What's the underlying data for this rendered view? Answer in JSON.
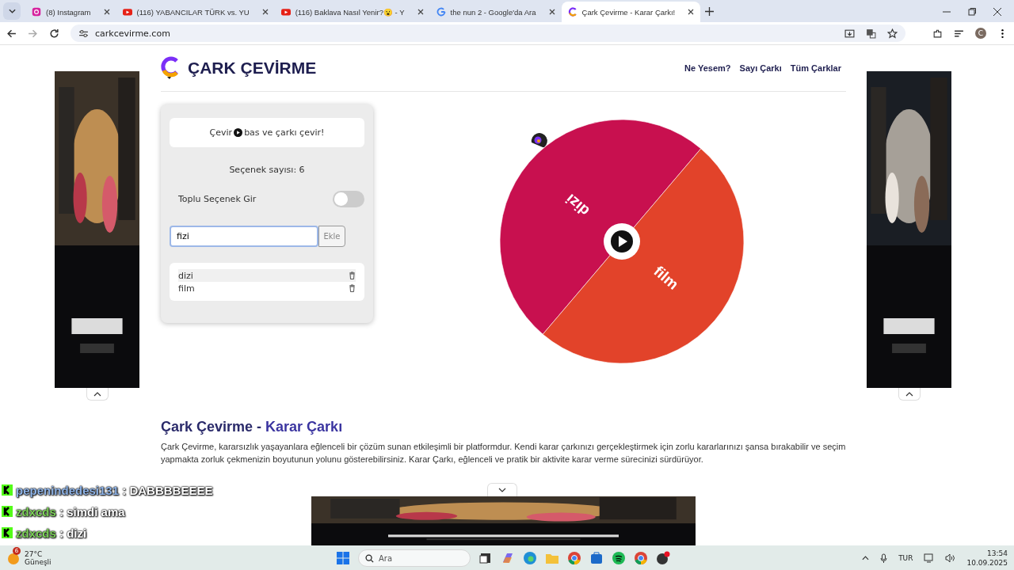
{
  "browser": {
    "tabs": [
      {
        "title": "(8) Instagram",
        "kind": "instagram",
        "selected": false
      },
      {
        "title": "(116) YABANCILAR TÜRK vs. YU",
        "kind": "youtube",
        "selected": false
      },
      {
        "title": "(116) Baklava Nasıl Yenir?😮 - Y",
        "kind": "youtube",
        "selected": false
      },
      {
        "title": "the nun 2 - Google'da Ara",
        "kind": "google",
        "selected": false
      },
      {
        "title": "Çark Çevirme - Karar Çarkı!",
        "kind": "site",
        "selected": true
      }
    ],
    "url": "carkcevirme.com",
    "profile": "C"
  },
  "page": {
    "logo": "ÇARK ÇEVİRME",
    "nav": [
      "Ne Yesem?",
      "Sayı Çarkı",
      "Tüm Çarklar"
    ],
    "panel": {
      "hint_before": "Çevir",
      "hint_after": "bas ve çarkı çevir!",
      "count": "Seçenek sayısı: 6",
      "bulk_toggle": {
        "label": "Toplu Seçenek Gir",
        "on": false
      },
      "input": {
        "value": "fizi"
      },
      "add_button": "Ekle",
      "options": [
        {
          "label": "dizi",
          "highlighted": true
        },
        {
          "label": "film",
          "highlighted": false
        }
      ]
    },
    "wheel": {
      "segments": [
        {
          "label": "dizi",
          "color": "#c8104f"
        },
        {
          "label": "film",
          "color": "#e2432a"
        }
      ]
    },
    "article": {
      "title": "Çark Çevirme - ",
      "title_accent": "Karar Çarkı",
      "body": "Çark Çevirme, kararsızlık yaşayanlara eğlenceli bir çözüm sunan etkileşimli bir platformdur. Kendi karar çarkınızı gerçekleştirmek için zorlu kararlarınızı şansa bırakabilir ve seçim yapmakta zorluk çekmenizin boyutunun yolunu gösterebilirsiniz. Karar Çarkı, eğlenceli ve pratik bir aktivite karar verme sürecinizi sürdürüyor."
    }
  },
  "chat": [
    {
      "user": "pepenindedesi131",
      "message": ": DABBBBEEEE",
      "color": "#8fb4e8"
    },
    {
      "user": "zdxcds",
      "message": ": simdi ama",
      "color": "#7ed35a"
    },
    {
      "user": "zdxcds",
      "message": ": dizi",
      "color": "#7ed35a"
    }
  ],
  "taskbar": {
    "weather": {
      "temp": "27°C",
      "condition": "Güneşli",
      "badge": "6"
    },
    "search": {
      "placeholder": "Ara"
    },
    "language": "TUR",
    "time": "13:54",
    "date": "10.09.2025"
  }
}
